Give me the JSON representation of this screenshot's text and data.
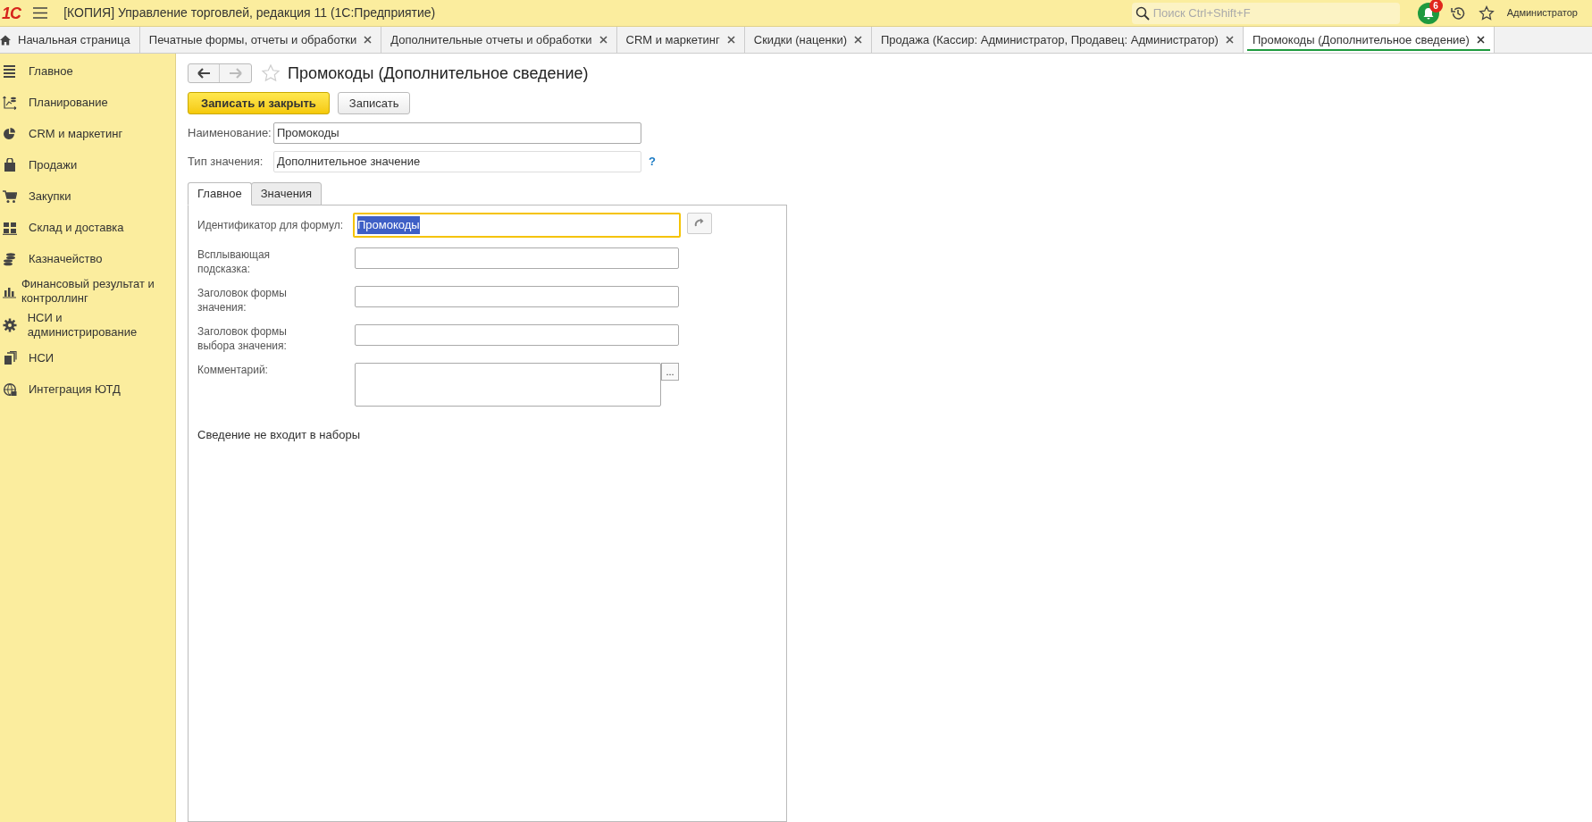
{
  "window": {
    "logo": "1С",
    "title": "[КОПИЯ] Управление торговлей, редакция 11  (1С:Предприятие)"
  },
  "search": {
    "placeholder": "Поиск Ctrl+Shift+F"
  },
  "notifications": {
    "count": "6"
  },
  "user": "Администратор",
  "tabs": [
    {
      "label": "Начальная страница",
      "selected": false,
      "kind": "home"
    },
    {
      "label": "Печатные формы, отчеты и обработки",
      "selected": false,
      "kind": "closable"
    },
    {
      "label": "Дополнительные отчеты и обработки",
      "selected": false,
      "kind": "closable"
    },
    {
      "label": "CRM и маркетинг",
      "selected": false,
      "kind": "closable"
    },
    {
      "label": "Скидки (наценки)",
      "selected": false,
      "kind": "closable"
    },
    {
      "label": "Продажа (Кассир: Администратор, Продавец: Администратор)",
      "selected": false,
      "kind": "closable"
    },
    {
      "label": "Промокоды (Дополнительное сведение)",
      "selected": true,
      "kind": "closable"
    }
  ],
  "sidebar": {
    "items": [
      {
        "label": "Главное",
        "kind": "list"
      },
      {
        "label": "Планирование",
        "kind": "axes"
      },
      {
        "label": "CRM и маркетинг",
        "kind": "pie"
      },
      {
        "label": "Продажи",
        "kind": "bag"
      },
      {
        "label": "Закупки",
        "kind": "cart"
      },
      {
        "label": "Склад и доставка",
        "kind": "grid"
      },
      {
        "label": "Казначейство",
        "kind": "coins"
      },
      {
        "label": "Финансовый результат и контроллинг",
        "kind": "bars"
      },
      {
        "label": "НСИ и администрирование",
        "kind": "gear"
      },
      {
        "label": "НСИ",
        "kind": "pages"
      },
      {
        "label": "Интеграция ЮТД",
        "kind": "globe"
      }
    ]
  },
  "form": {
    "back_disabled": false,
    "forward_disabled": true,
    "title": "Промокоды (Дополнительное сведение)",
    "buttons": [
      {
        "label": "Записать и закрыть",
        "kind": "primary"
      },
      {
        "label": "Записать",
        "kind": "default"
      }
    ],
    "fields": [
      {
        "label": "Наименование:",
        "value": "Промокоды",
        "kind": "input"
      },
      {
        "label": "Тип значения:",
        "value": "Дополнительное значение",
        "kind": "readonly",
        "help": "?"
      }
    ],
    "tabs": [
      {
        "label": "Главное",
        "selected": true
      },
      {
        "label": "Значения",
        "selected": false
      }
    ],
    "panel_fields": [
      {
        "label": "Идентификатор для формул:",
        "value": "Промокоды",
        "kind": "refresh",
        "focused": true
      },
      {
        "label": "Всплывающая подсказка:",
        "kind": "input",
        "focused": false
      },
      {
        "label": "Заголовок формы значения:",
        "kind": "input",
        "focused": false
      },
      {
        "label": "Заголовок формы выбора значения:",
        "kind": "input",
        "focused": false
      },
      {
        "label": "Комментарий:",
        "kind": "multiline",
        "button": "...",
        "focused": false
      }
    ],
    "note": "Сведение не входит в наборы"
  }
}
